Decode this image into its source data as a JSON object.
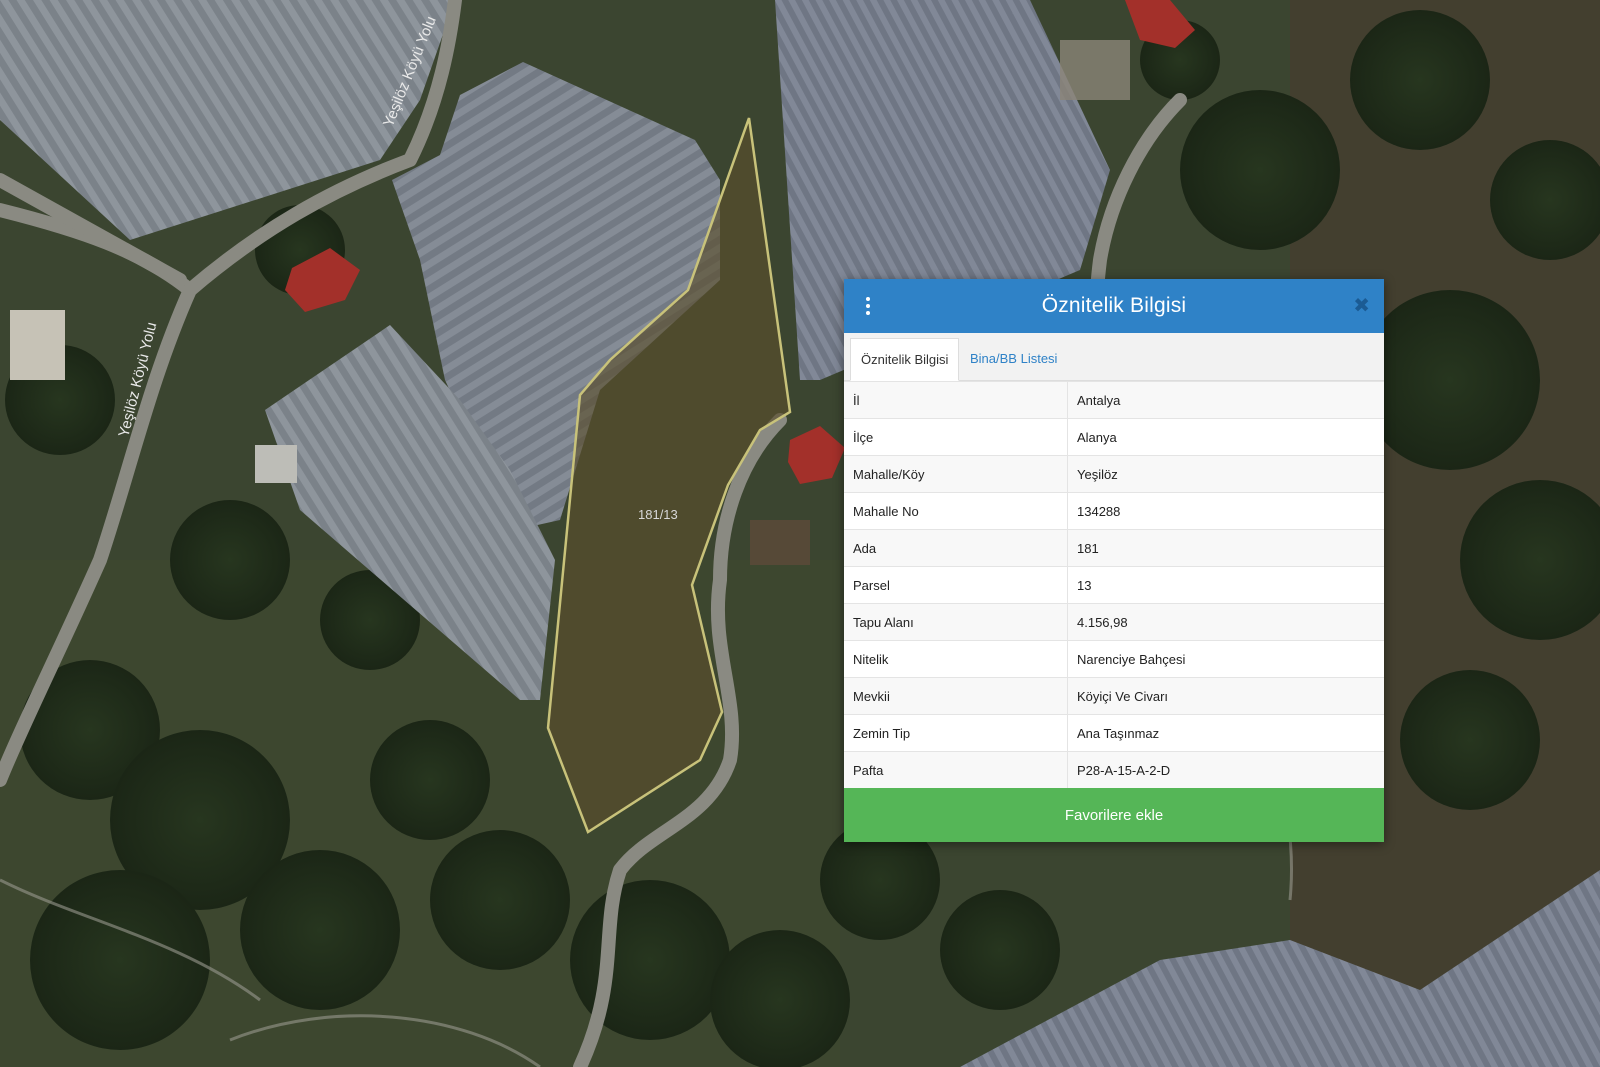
{
  "map": {
    "road_labels": [
      "Yeşilöz Köyü Yolu",
      "Yeşilöz Köyü Yolu"
    ],
    "parcel_label": "181/13"
  },
  "panel": {
    "title": "Öznitelik Bilgisi",
    "menu_icon": "kebab-menu-icon",
    "close_icon": "close-icon",
    "close_glyph": "✖",
    "tabs": [
      {
        "label": "Öznitelik Bilgisi",
        "active": true
      },
      {
        "label": "Bina/BB Listesi",
        "active": false
      }
    ],
    "rows": [
      {
        "key": "İl",
        "value": "Antalya"
      },
      {
        "key": "İlçe",
        "value": "Alanya"
      },
      {
        "key": "Mahalle/Köy",
        "value": "Yeşilöz"
      },
      {
        "key": "Mahalle No",
        "value": "134288"
      },
      {
        "key": "Ada",
        "value": "181"
      },
      {
        "key": "Parsel",
        "value": "13"
      },
      {
        "key": "Tapu Alanı",
        "value": "4.156,98"
      },
      {
        "key": "Nitelik",
        "value": "Narenciye Bahçesi"
      },
      {
        "key": "Mevkii",
        "value": "Köyiçi Ve Civarı"
      },
      {
        "key": "Zemin Tip",
        "value": "Ana Taşınmaz"
      },
      {
        "key": "Pafta",
        "value": "P28-A-15-A-2-D"
      }
    ],
    "favorite_button": "Favorilere ekle"
  },
  "colors": {
    "header": "#2f82c7",
    "favorite_button": "#55b657",
    "parcel_outline": "#c8c27a"
  }
}
